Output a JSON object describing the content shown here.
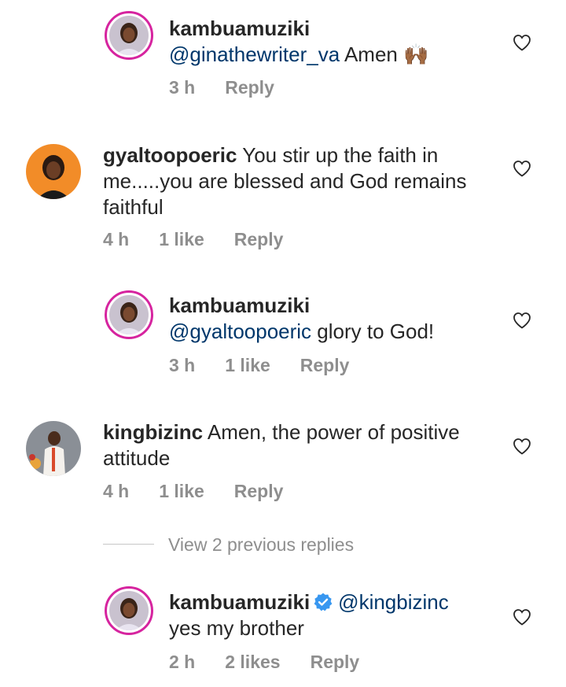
{
  "comments": [
    {
      "username": "kambuamuziki",
      "mention": "@ginathewriter_va",
      "text": " Amen",
      "emoji": "🙌🏾",
      "time": "3 h",
      "likes": "",
      "reply": "Reply"
    },
    {
      "username": "gyaltoopoeric",
      "text": " You stir up the faith in me.....you are blessed and God remains faithful",
      "time": "4 h",
      "likes": "1 like",
      "reply": "Reply"
    },
    {
      "username": "kambuamuziki",
      "mention": "@gyaltoopoeric",
      "text": " glory to God!",
      "time": "3 h",
      "likes": "1 like",
      "reply": "Reply"
    },
    {
      "username": "kingbizinc",
      "text": " Amen, the power of positive attitude",
      "time": "4 h",
      "likes": "1 like",
      "reply": "Reply"
    },
    {
      "username": "kambuamuziki",
      "mention": "@kingbizinc",
      "text": "yes my brother",
      "time": "2 h",
      "likes": "2 likes",
      "reply": "Reply"
    }
  ],
  "view_replies": "View 2 previous replies",
  "colors": {
    "mention": "#00376b",
    "meta": "#8e8e8e",
    "verified": "#3897f0",
    "story_ring": "#d6249f"
  }
}
